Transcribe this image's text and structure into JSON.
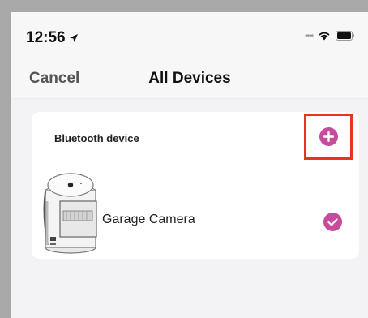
{
  "status_bar": {
    "time": "12:56",
    "icons": [
      "location-arrow-icon",
      "signal-dots-icon",
      "wifi-icon",
      "battery-icon"
    ]
  },
  "nav": {
    "cancel_label": "Cancel",
    "title": "All Devices"
  },
  "bluetooth_section": {
    "title": "Bluetooth device",
    "add_icon": "plus-circle-icon",
    "devices": [
      {
        "name": "Garage Camera",
        "selected": true,
        "icon": "check-circle-icon"
      }
    ]
  },
  "colors": {
    "accent": "#c94b9b",
    "highlight": "#ea3323",
    "card": "#ffffff",
    "background": "#f3f3f5"
  }
}
